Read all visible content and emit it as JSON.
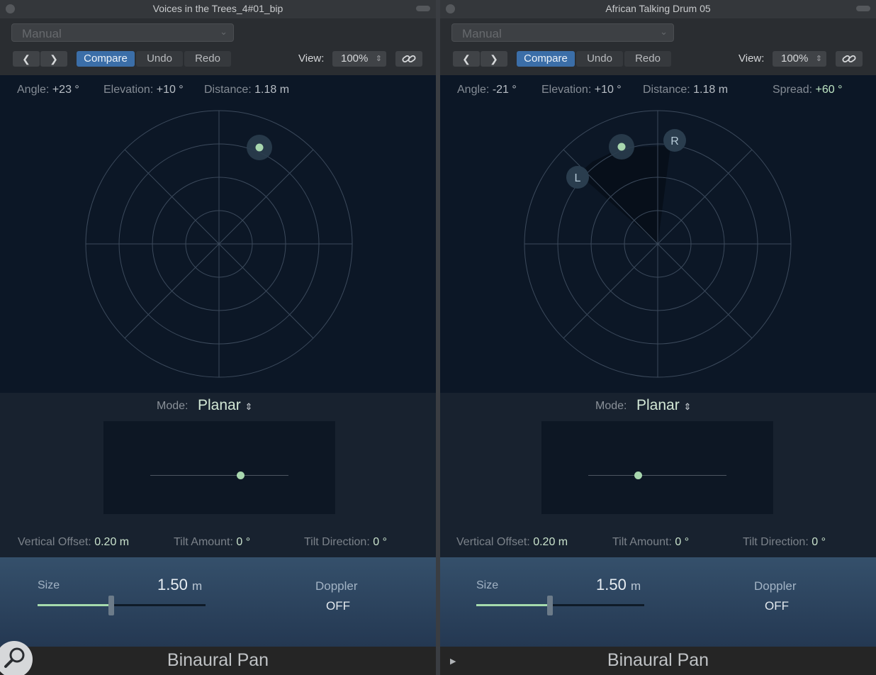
{
  "windows": [
    {
      "title": "Voices in the Trees_4#01_bip",
      "preset": "Manual",
      "toolbar": {
        "compare": "Compare",
        "undo": "Undo",
        "redo": "Redo",
        "view_label": "View:",
        "zoom": "100%"
      },
      "readout": {
        "angle_label": "Angle:",
        "angle": "+23 °",
        "elevation_label": "Elevation:",
        "elevation": "+10 °",
        "distance_label": "Distance:",
        "distance": "1.18 m"
      },
      "panner": {
        "angle_deg": 23
      },
      "mode": {
        "label": "Mode:",
        "value": "Planar"
      },
      "tilt_slider": {
        "position": 0.65
      },
      "params": {
        "vertical_offset_label": "Vertical Offset:",
        "vertical_offset": "0.20 m",
        "tilt_amount_label": "Tilt Amount:",
        "tilt_amount": "0 °",
        "tilt_direction_label": "Tilt Direction:",
        "tilt_direction": "0 °"
      },
      "size": {
        "label": "Size",
        "value": "1.50",
        "unit": "m",
        "slider_fraction": 0.43
      },
      "doppler": {
        "label": "Doppler",
        "value": "OFF"
      },
      "plugin_name": "Binaural Pan"
    },
    {
      "title": "African Talking Drum 05",
      "preset": "Manual",
      "toolbar": {
        "compare": "Compare",
        "undo": "Undo",
        "redo": "Redo",
        "view_label": "View:",
        "zoom": "100%"
      },
      "readout": {
        "angle_label": "Angle:",
        "angle": "-21 °",
        "elevation_label": "Elevation:",
        "elevation": "+10 °",
        "distance_label": "Distance:",
        "distance": "1.18 m",
        "spread_label": "Spread:",
        "spread": "+60 °"
      },
      "panner": {
        "angle_deg": -21,
        "l_label": "L",
        "r_label": "R"
      },
      "mode": {
        "label": "Mode:",
        "value": "Planar"
      },
      "tilt_slider": {
        "position": 0.36
      },
      "params": {
        "vertical_offset_label": "Vertical Offset:",
        "vertical_offset": "0.20 m",
        "tilt_amount_label": "Tilt Amount:",
        "tilt_amount": "0 °",
        "tilt_direction_label": "Tilt Direction:",
        "tilt_direction": "0 °"
      },
      "size": {
        "label": "Size",
        "value": "1.50",
        "unit": "m",
        "slider_fraction": 0.43
      },
      "doppler": {
        "label": "Doppler",
        "value": "OFF"
      },
      "plugin_name": "Binaural Pan"
    }
  ],
  "colors": {
    "accent": "#3b6ea8",
    "source_dot": "#a8d7ae",
    "background": "#0c1726"
  },
  "icons": [
    "chevron-left-icon",
    "chevron-right-icon",
    "link-icon",
    "up-down-chevron-icon",
    "play-triangle-icon",
    "magnifier-icon"
  ]
}
